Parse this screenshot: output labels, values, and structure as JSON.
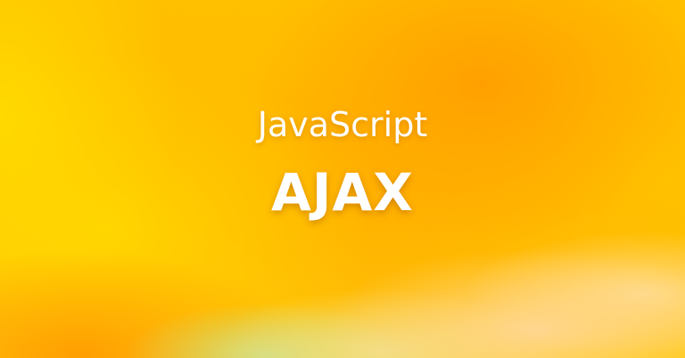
{
  "banner": {
    "subtitle": "JavaScript",
    "title": "AJAX"
  },
  "colors": {
    "background_primary": "#ffc000",
    "background_accent": "#ffa000",
    "text": "#ffffff"
  }
}
